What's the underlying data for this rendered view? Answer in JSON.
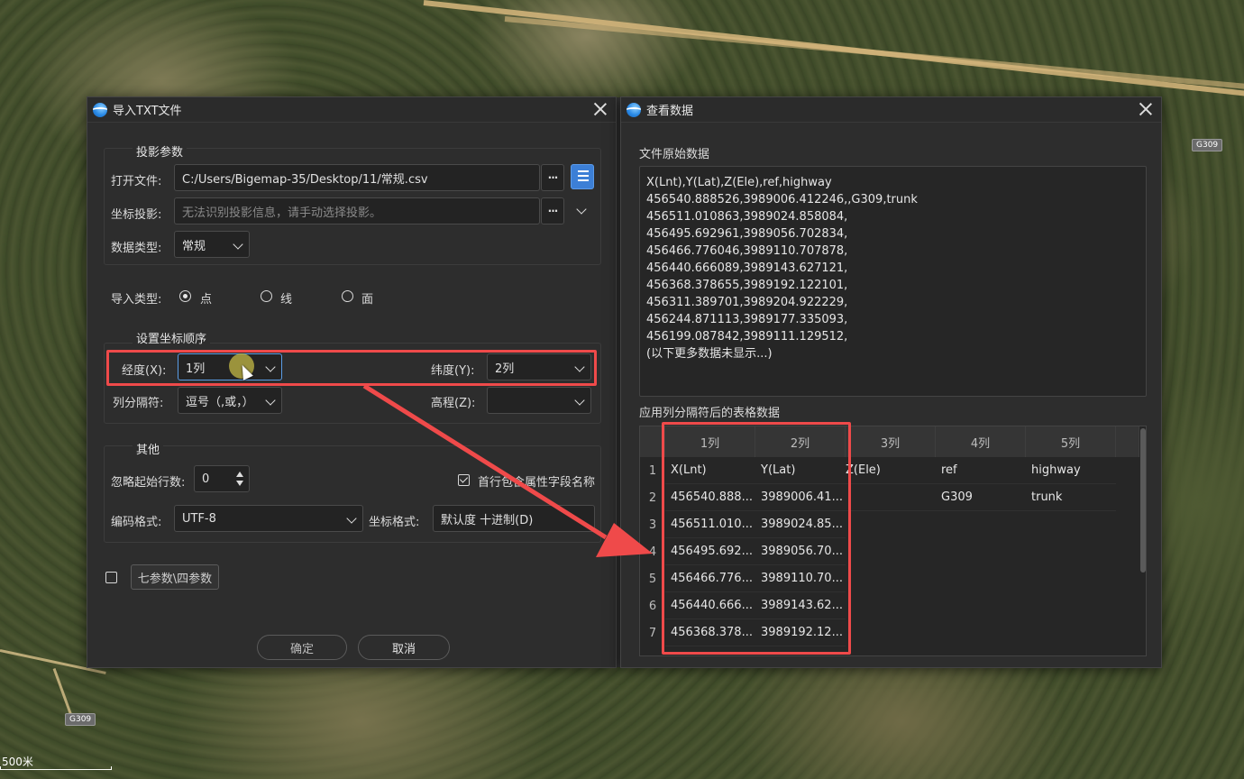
{
  "map": {
    "road_badges": [
      "G309",
      "G309"
    ],
    "scale_label": "500米"
  },
  "import_dialog": {
    "title": "导入TXT文件",
    "projection_group": {
      "title": "投影参数",
      "open_file_label": "打开文件:",
      "open_file_value": "C:/Users/Bigemap-35/Desktop/11/常规.csv",
      "coord_projection_label": "坐标投影:",
      "coord_projection_placeholder": "无法识别投影信息，请手动选择投影。",
      "data_type_label": "数据类型:",
      "data_type_value": "常规",
      "dots": "···"
    },
    "import_type": {
      "label": "导入类型:",
      "options": [
        "点",
        "线",
        "面"
      ],
      "selected": "点"
    },
    "coord_order_group": {
      "title": "设置坐标顺序",
      "lon_label": "经度(X):",
      "lon_value": "1列",
      "lat_label": "纬度(Y):",
      "lat_value": "2列",
      "sep_label": "列分隔符:",
      "sep_value": "逗号（,或，）",
      "elev_label": "高程(Z):",
      "elev_value": ""
    },
    "other_group": {
      "title": "其他",
      "skip_rows_label": "忽略起始行数:",
      "skip_rows_value": "0",
      "header_checkbox_label": "首行包含属性字段名称",
      "header_checked": true,
      "encoding_label": "编码格式:",
      "encoding_value": "UTF-8",
      "coord_format_label": "坐标格式:",
      "coord_format_value": "默认度 十进制(D)"
    },
    "seven_param_label": "七参数\\四参数",
    "seven_param_checked": false,
    "ok_label": "确定",
    "cancel_label": "取消"
  },
  "view_dialog": {
    "title": "查看数据",
    "raw_title": "文件原始数据",
    "raw_lines": [
      "X(Lnt),Y(Lat),Z(Ele),ref,highway",
      "456540.888526,3989006.412246,,G309,trunk",
      "456511.010863,3989024.858084,",
      "456495.692961,3989056.702834,",
      "456466.776046,3989110.707878,",
      "456440.666089,3989143.627121,",
      "456368.378655,3989192.122101,",
      "456311.389701,3989204.922229,",
      "456244.871113,3989177.335093,",
      "456199.087842,3989111.129512,",
      "(以下更多数据未显示...)"
    ],
    "table_title": "应用列分隔符后的表格数据",
    "table": {
      "headers": [
        "1列",
        "2列",
        "3列",
        "4列",
        "5列"
      ],
      "row_numbers": [
        "1",
        "2",
        "3",
        "4",
        "5",
        "6",
        "7"
      ],
      "rows": [
        [
          "X(Lnt)",
          "Y(Lat)",
          "Z(Ele)",
          "ref",
          "highway"
        ],
        [
          "456540.888...",
          "3989006.41...",
          "",
          "G309",
          "trunk"
        ],
        [
          "456511.010...",
          "3989024.85...",
          "",
          "",
          ""
        ],
        [
          "456495.692...",
          "3989056.70...",
          "",
          "",
          ""
        ],
        [
          "456466.776...",
          "3989110.70...",
          "",
          "",
          ""
        ],
        [
          "456440.666...",
          "3989143.62...",
          "",
          "",
          ""
        ],
        [
          "456368.378...",
          "3989192.12...",
          "",
          "",
          ""
        ]
      ]
    }
  },
  "colors": {
    "annotation_red": "#ef4a4a",
    "dialog_bg": "#2d2d2d",
    "accent_blue": "#3c7fd6"
  }
}
